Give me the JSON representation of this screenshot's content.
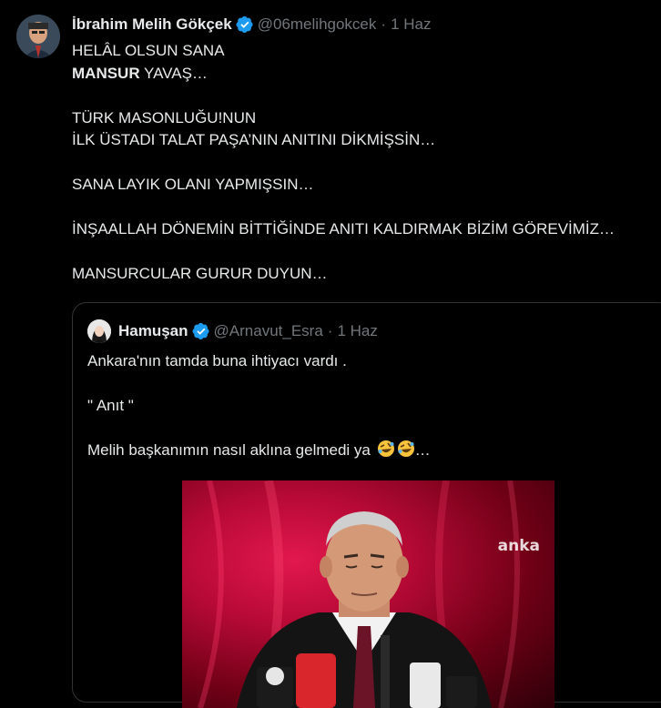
{
  "tweet": {
    "author_name": "İbrahim Melih Gökçek",
    "author_handle": "@06melihgokcek",
    "separator": "·",
    "date": "1 Haz",
    "lines": [
      {
        "text": "HELÂL OLSUN SANA"
      },
      {
        "bold": "MANSUR",
        "text": " YAVAŞ…"
      },
      {
        "gap": true
      },
      {
        "text": "TÜRK MASONLUĞU!NUN"
      },
      {
        "text": "İLK ÜSTADI TALAT PAŞA’NIN ANITINI DİKMİŞSİN…"
      },
      {
        "gap": true
      },
      {
        "text": "SANA LAYIK OLANI YAPMIŞSIN…"
      },
      {
        "gap": true
      },
      {
        "text": "İNŞAALLAH DÖNEMİN BİTTİĞİNDE ANITI KALDIRMAK BİZİM GÖREVİMİZ…"
      },
      {
        "gap": true
      },
      {
        "text": "MANSURCULAR GURUR DUYUN…"
      }
    ]
  },
  "quoted_tweet": {
    "author_name": "Hamuşan",
    "author_handle": "@Arnavut_Esra",
    "separator": "·",
    "date": "1 Haz",
    "line1": "Ankara'nın tamda buna ihtiyacı vardı .",
    "line2": "\" Anıt \"",
    "line3": "Melih başkanımın nasıl aklına gelmedi ya",
    "line3_suffix": "…",
    "emoji": [
      "rofl-emoji",
      "rofl-emoji"
    ],
    "video_logo": "anka"
  },
  "colors": {
    "background": "#000000",
    "text": "#e7e9ea",
    "muted": "#71767b",
    "verified": "#1d9bf0",
    "border": "#2f3336"
  }
}
